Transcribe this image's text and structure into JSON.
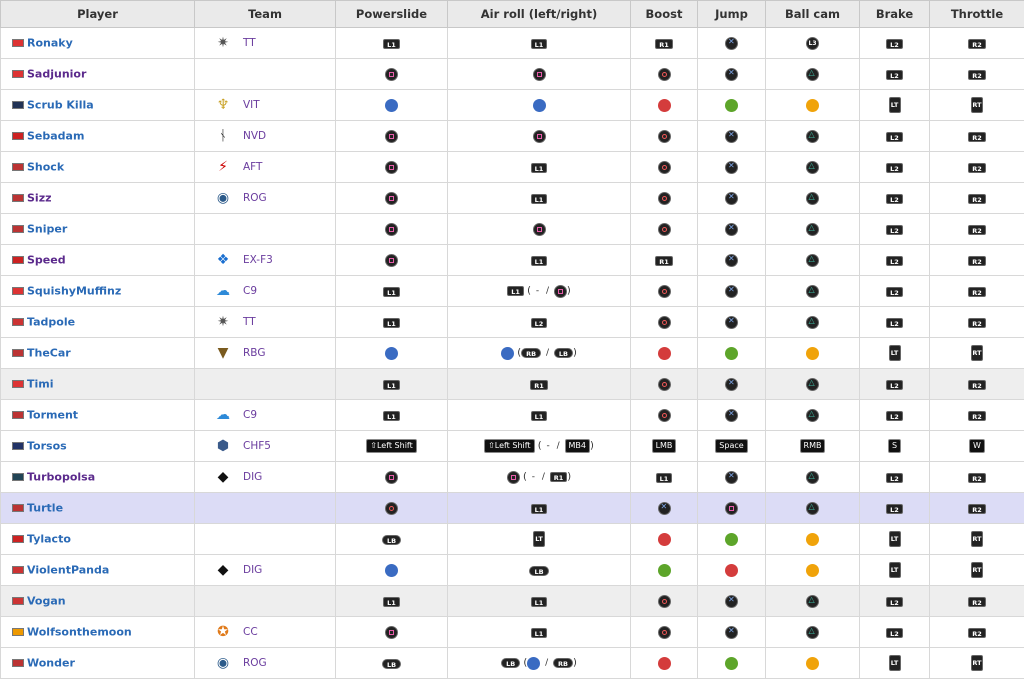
{
  "headers": [
    "Player",
    "Team",
    "Powerslide",
    "Air roll (left/right)",
    "Boost",
    "Jump",
    "Ball cam",
    "Brake",
    "Throttle"
  ],
  "rows": [
    {
      "player": "Ronaky",
      "team": "TT",
      "ps": "L1",
      "air": "L1",
      "boost": "R1",
      "jump": "Cross",
      "cam": "L3",
      "brake": "L2",
      "thr": "R2"
    },
    {
      "player": "Sadjunior",
      "team": "",
      "ps": "Square",
      "air": "Square",
      "boost": "Circle",
      "jump": "Cross",
      "cam": "Triangle",
      "brake": "L2",
      "thr": "R2"
    },
    {
      "player": "Scrub Killa",
      "team": "VIT",
      "ps": "X",
      "air": "X",
      "boost": "B",
      "jump": "A",
      "cam": "Y",
      "brake": "LT",
      "thr": "RT"
    },
    {
      "player": "Sebadam",
      "team": "NVD",
      "ps": "Square",
      "air": "Square",
      "boost": "Circle",
      "jump": "Cross",
      "cam": "Triangle",
      "brake": "L2",
      "thr": "R2"
    },
    {
      "player": "Shock",
      "team": "AFT",
      "ps": "Square",
      "air": "L1",
      "boost": "Circle",
      "jump": "Cross",
      "cam": "Triangle",
      "brake": "L2",
      "thr": "R2"
    },
    {
      "player": "Sizz",
      "team": "ROG",
      "ps": "Square",
      "air": "L1",
      "boost": "Circle",
      "jump": "Cross",
      "cam": "Triangle",
      "brake": "L2",
      "thr": "R2"
    },
    {
      "player": "Sniper",
      "team": "",
      "ps": "Square",
      "air": "Square",
      "boost": "Circle",
      "jump": "Cross",
      "cam": "Triangle",
      "brake": "L2",
      "thr": "R2"
    },
    {
      "player": "Speed",
      "team": "EX-F3",
      "ps": "Square",
      "air": "L1",
      "boost": "R1",
      "jump": "Cross",
      "cam": "Triangle",
      "brake": "L2",
      "thr": "R2"
    },
    {
      "player": "SquishyMuffinz",
      "team": "C9",
      "ps": "L1",
      "air": "L1 ( - / Square)",
      "boost": "Circle",
      "jump": "Cross",
      "cam": "Triangle",
      "brake": "L2",
      "thr": "R2"
    },
    {
      "player": "Tadpole",
      "team": "TT",
      "ps": "L1",
      "air": "L2",
      "boost": "Circle",
      "jump": "Cross",
      "cam": "Triangle",
      "brake": "L2",
      "thr": "R2"
    },
    {
      "player": "TheCar",
      "team": "RBG",
      "ps": "X",
      "air": "X (RB / LB)",
      "boost": "B",
      "jump": "A",
      "cam": "Y",
      "brake": "LT",
      "thr": "RT"
    },
    {
      "player": "Timi",
      "team": "",
      "ps": "L1",
      "air": "R1",
      "boost": "Circle",
      "jump": "Cross",
      "cam": "Triangle",
      "brake": "L2",
      "thr": "R2"
    },
    {
      "player": "Torment",
      "team": "C9",
      "ps": "L1",
      "air": "L1",
      "boost": "Circle",
      "jump": "Cross",
      "cam": "Triangle",
      "brake": "L2",
      "thr": "R2"
    },
    {
      "player": "Torsos",
      "team": "CHF5",
      "ps": "⇧Left Shift",
      "air": "⇧Left Shift ( - / MB4)",
      "boost": "LMB",
      "jump": "Space",
      "cam": "RMB",
      "brake": "S",
      "thr": "W"
    },
    {
      "player": "Turbopolsa",
      "team": "DIG",
      "ps": "Square",
      "air": "Square ( - / R1)",
      "boost": "L1",
      "jump": "Cross",
      "cam": "Triangle",
      "brake": "L2",
      "thr": "R2"
    },
    {
      "player": "Turtle",
      "team": "",
      "ps": "Circle",
      "air": "L1",
      "boost": "Cross",
      "jump": "Square",
      "cam": "Triangle",
      "brake": "L2",
      "thr": "R2"
    },
    {
      "player": "Tylacto",
      "team": "",
      "ps": "LB",
      "air": "LT",
      "boost": "B",
      "jump": "A",
      "cam": "Y",
      "brake": "LT",
      "thr": "RT"
    },
    {
      "player": "ViolentPanda",
      "team": "DIG",
      "ps": "X",
      "air": "LB",
      "boost": "A",
      "jump": "B",
      "cam": "Y",
      "brake": "LT",
      "thr": "RT"
    },
    {
      "player": "Vogan",
      "team": "",
      "ps": "L1",
      "air": "L1",
      "boost": "Circle",
      "jump": "Cross",
      "cam": "Triangle",
      "brake": "L2",
      "thr": "R2"
    },
    {
      "player": "Wolfsonthemoon",
      "team": "CC",
      "ps": "Square",
      "air": "L1",
      "boost": "Circle",
      "jump": "Cross",
      "cam": "Triangle",
      "brake": "L2",
      "thr": "R2"
    },
    {
      "player": "Wonder",
      "team": "ROG",
      "ps": "LB",
      "air": "LB (X / RB)",
      "boost": "B",
      "jump": "A",
      "cam": "Y",
      "brake": "LT",
      "thr": "RT"
    }
  ]
}
